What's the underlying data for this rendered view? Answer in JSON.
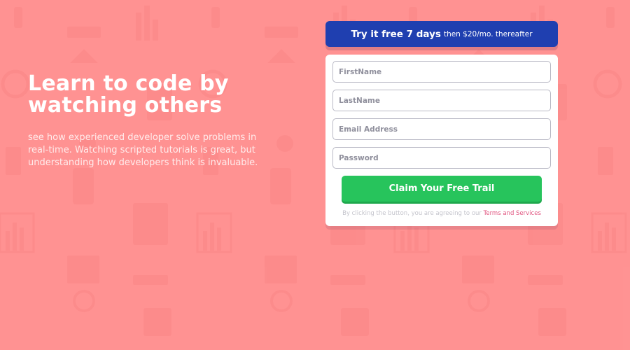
{
  "hero": {
    "title": "Learn to code by watching others",
    "description": "see how experienced developer solve problems in real-time. Watching scripted tutorials is great, but understanding how developers think is invaluable."
  },
  "promo": {
    "highlight": "Try it free 7 days",
    "rest": "then $20/mo. thereafter"
  },
  "form": {
    "first_name_placeholder": "FirstName",
    "last_name_placeholder": "LastName",
    "email_placeholder": "Email Address",
    "password_placeholder": "Password",
    "submit_label": "Claim Your Free Trail",
    "legal_text": "By clicking the button, you are agreeing to our",
    "legal_link": "Terms and Services"
  },
  "colors": {
    "background": "#ff8a8a",
    "banner": "#1f3fb0",
    "cta": "#27c45c",
    "link": "#e0547f"
  }
}
